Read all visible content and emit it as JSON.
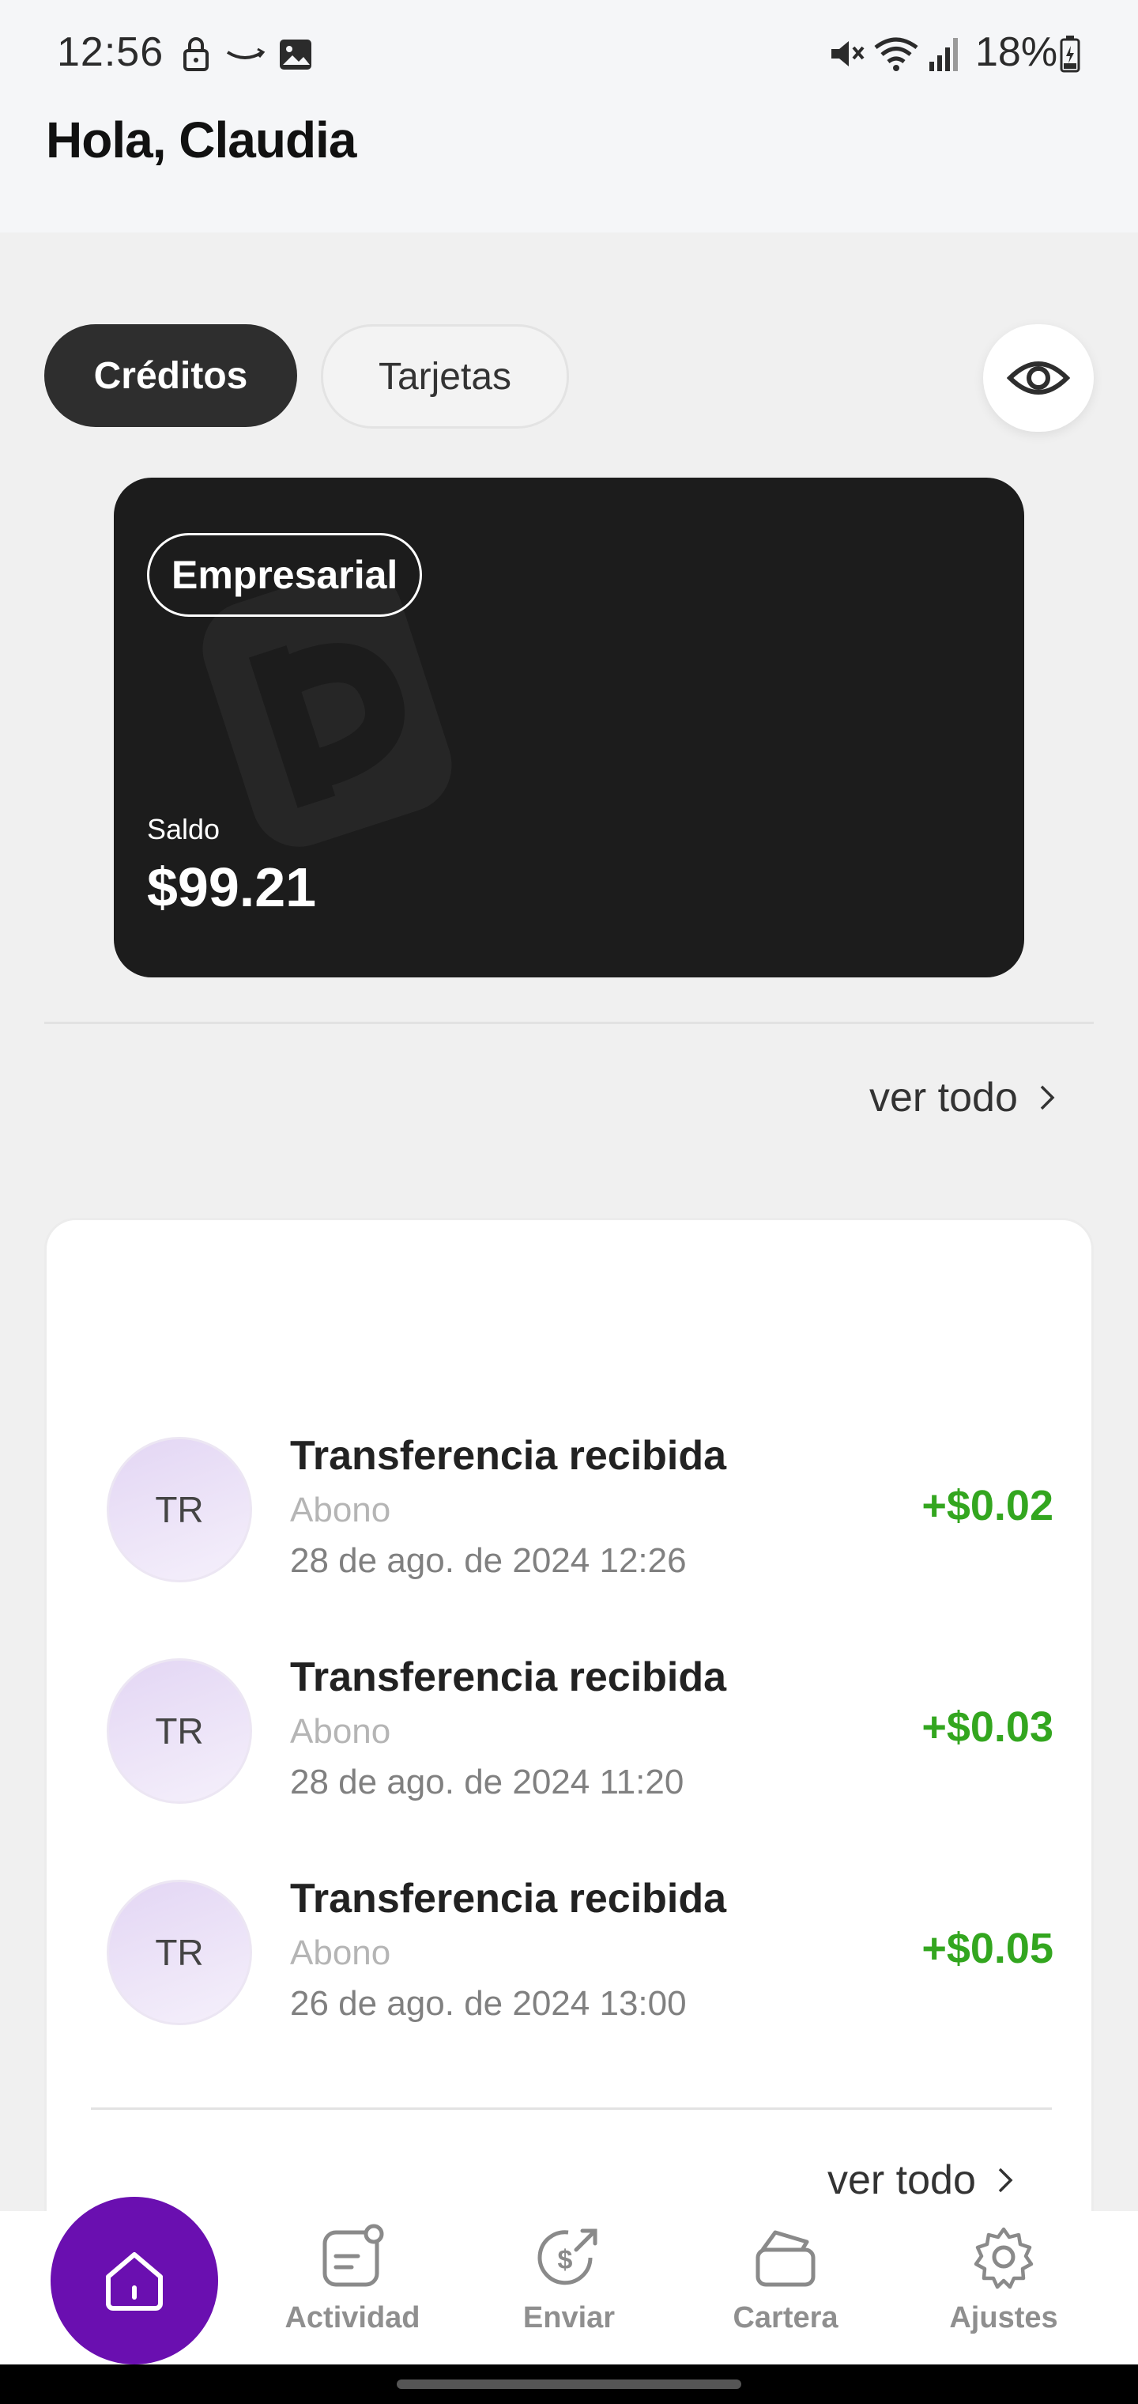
{
  "status_bar": {
    "time": "12:56",
    "battery": "18%"
  },
  "header": {
    "greeting": "Hola, Claudia"
  },
  "tabs": [
    {
      "label": "Créditos",
      "active": true
    },
    {
      "label": "Tarjetas",
      "active": false
    }
  ],
  "card": {
    "badge": "Empresarial",
    "balance_label": "Saldo",
    "balance": "$99.21"
  },
  "see_all": "ver todo",
  "transactions": [
    {
      "avatar": "TR",
      "title": "Transferencia recibida",
      "subtitle": "Abono",
      "date": "28 de ago. de 2024 12:26",
      "amount": "+$0.02"
    },
    {
      "avatar": "TR",
      "title": "Transferencia recibida",
      "subtitle": "Abono",
      "date": "28 de ago. de 2024 11:20",
      "amount": "+$0.03"
    },
    {
      "avatar": "TR",
      "title": "Transferencia recibida",
      "subtitle": "Abono",
      "date": "26 de ago. de 2024 13:00",
      "amount": "+$0.05"
    }
  ],
  "bottom_nav": [
    {
      "label": "Actividad",
      "icon": "activity-icon"
    },
    {
      "label": "Enviar",
      "icon": "send-money-icon"
    },
    {
      "label": "Cartera",
      "icon": "wallet-icon"
    },
    {
      "label": "Ajustes",
      "icon": "gear-icon"
    }
  ],
  "colors": {
    "accent": "#6a0fb0",
    "positive": "#33a61f",
    "card": "#1c1c1c"
  }
}
